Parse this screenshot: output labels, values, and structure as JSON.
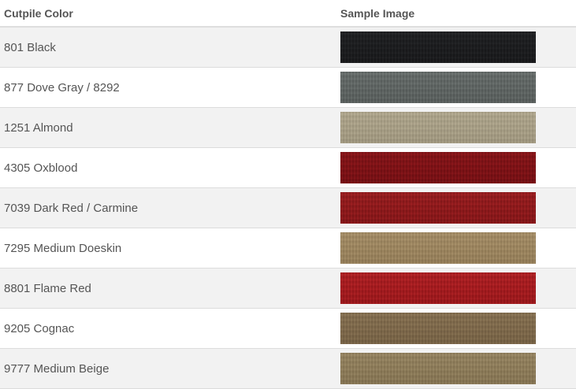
{
  "table": {
    "headers": {
      "color": "Cutpile Color",
      "sample": "Sample Image"
    },
    "rows": [
      {
        "name": "801 Black",
        "swatch": {
          "base": "#1c1d1f",
          "hi": "#3a3b3d",
          "lo": "#0e0e10"
        }
      },
      {
        "name": "877 Dove Gray / 8292",
        "swatch": {
          "base": "#5f6563",
          "hi": "#8b918f",
          "lo": "#3f4443"
        }
      },
      {
        "name": "1251 Almond",
        "swatch": {
          "base": "#a89f86",
          "hi": "#cdc5ad",
          "lo": "#7f7763"
        }
      },
      {
        "name": "4305 Oxblood",
        "swatch": {
          "base": "#7e1216",
          "hi": "#b0262a",
          "lo": "#52090c"
        }
      },
      {
        "name": "7039 Dark Red / Carmine",
        "swatch": {
          "base": "#8f1a1c",
          "hi": "#c13033",
          "lo": "#5e0c0e"
        }
      },
      {
        "name": "7295 Medium Doeskin",
        "swatch": {
          "base": "#9d8660",
          "hi": "#c4ad86",
          "lo": "#735f40"
        }
      },
      {
        "name": "8801 Flame Red",
        "swatch": {
          "base": "#a61b1f",
          "hi": "#d23a3b",
          "lo": "#700d10"
        }
      },
      {
        "name": "9205 Cognac",
        "swatch": {
          "base": "#7f6a4c",
          "hi": "#a58e6c",
          "lo": "#574630"
        }
      },
      {
        "name": "9777 Medium Beige",
        "swatch": {
          "base": "#8e7d5b",
          "hi": "#b3a27e",
          "lo": "#66563a"
        }
      }
    ]
  }
}
